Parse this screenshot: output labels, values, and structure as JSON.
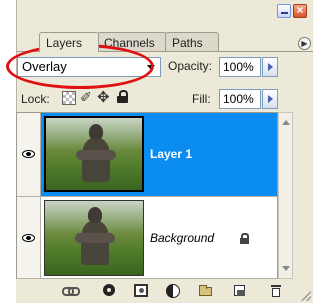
{
  "window": {
    "close_glyph": "×"
  },
  "tabs": [
    {
      "label": "Layers",
      "active": true
    },
    {
      "label": "Channels",
      "active": false
    },
    {
      "label": "Paths",
      "active": false
    }
  ],
  "blend": {
    "mode": "Overlay",
    "opacity_label": "Opacity:",
    "opacity_value": "100%"
  },
  "lock": {
    "label": "Lock:",
    "move_glyph": "✥",
    "paint_glyph": "✐",
    "fill_label": "Fill:",
    "fill_value": "100%"
  },
  "layers": [
    {
      "name": "Layer 1",
      "selected": true,
      "visible": true
    },
    {
      "name": "Background",
      "selected": false,
      "visible": true,
      "locked": true
    }
  ],
  "colors": {
    "selection": "#0a8cf0",
    "panel": "#ece9d8",
    "annotation": "#e01010"
  }
}
